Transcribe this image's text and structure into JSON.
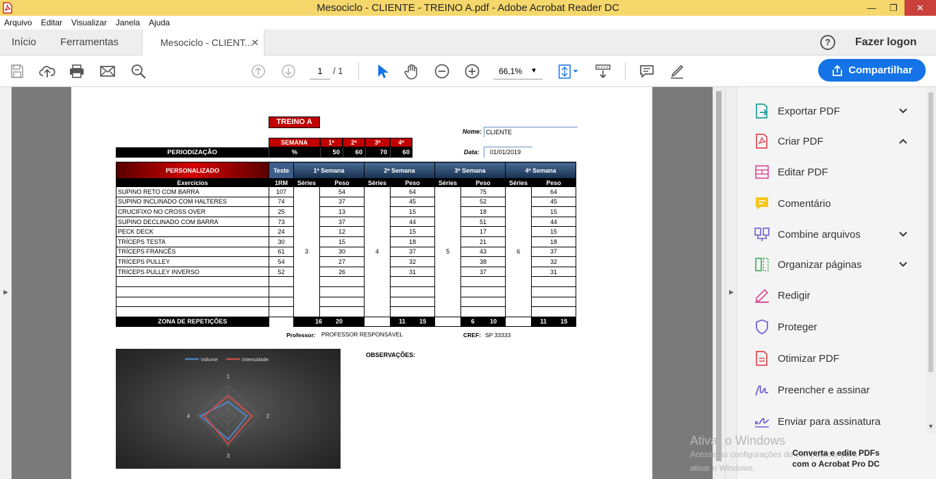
{
  "window": {
    "title": "Mesociclo - CLIENTE  - TREINO A.pdf - Adobe Acrobat Reader DC"
  },
  "menu": [
    "Arquivo",
    "Editar",
    "Visualizar",
    "Janela",
    "Ajuda"
  ],
  "tabs": {
    "home": "Início",
    "tools": "Ferramentas",
    "document": "Mesociclo - CLIENT...",
    "login": "Fazer logon"
  },
  "toolbar": {
    "current_page": "1",
    "total_pages": "/ 1",
    "zoom": "66,1%",
    "share_label": "Compartilhar"
  },
  "tools_pane": [
    {
      "label": "Exportar PDF"
    },
    {
      "label": "Criar PDF"
    },
    {
      "label": "Editar PDF"
    },
    {
      "label": "Comentário"
    },
    {
      "label": "Combine arquivos"
    },
    {
      "label": "Organizar páginas"
    },
    {
      "label": "Redigir"
    },
    {
      "label": "Proteger"
    },
    {
      "label": "Otimizar PDF"
    },
    {
      "label": "Preencher e assinar"
    },
    {
      "label": "Enviar para assinatura"
    }
  ],
  "promo": {
    "line1": "Converta e edite PDFs",
    "line2": "com o Acrobat Pro DC"
  },
  "watermark": {
    "title": "Ativar o Windows",
    "line1": "Acesse as configurações do computador para",
    "line2": "ativar o Windows."
  },
  "doc": {
    "title": "TREINO A",
    "nome_label": "Nome:",
    "nome_value": "CLIENTE",
    "data_label": "Data:",
    "data_value": "01/01/2019",
    "semana_label": "SEMANA",
    "semanas": [
      "1ª",
      "2ª",
      "3ª",
      "4ª"
    ],
    "periodizacao_label": "PERIODIZAÇÃO",
    "percent_label": "%",
    "percentuais": [
      "50",
      "60",
      "70",
      "60"
    ],
    "personalizado": "PERSONALIZADO",
    "teste": "Teste",
    "week_headers": [
      "1ª Semana",
      "2ª Semana",
      "3ª Semana",
      "4ª Semana"
    ],
    "exercicios_label": "Exercícios",
    "rm_label": "1RM",
    "series_label": "Séries",
    "peso_label": "Peso",
    "series_values": [
      "3",
      "4",
      "5",
      "6"
    ],
    "exercises": [
      {
        "name": "SUPINO RETO COM BARRA",
        "rm": "107",
        "w": [
          "54",
          "64",
          "75",
          "64"
        ]
      },
      {
        "name": "SUPINO INCLINADO COM HALTERES",
        "rm": "74",
        "w": [
          "37",
          "45",
          "52",
          "45"
        ]
      },
      {
        "name": "CRUCIFIXO NO CROSS OVER",
        "rm": "25",
        "w": [
          "13",
          "15",
          "18",
          "15"
        ]
      },
      {
        "name": "SUPINO DECLINADO COM BARRA",
        "rm": "73",
        "w": [
          "37",
          "44",
          "51",
          "44"
        ]
      },
      {
        "name": "PECK DECK",
        "rm": "24",
        "w": [
          "12",
          "15",
          "17",
          "15"
        ]
      },
      {
        "name": "TRÍCEPS TESTA",
        "rm": "30",
        "w": [
          "15",
          "18",
          "21",
          "18"
        ]
      },
      {
        "name": "TRÍCEPS FRANCÊS",
        "rm": "61",
        "w": [
          "30",
          "37",
          "43",
          "37"
        ]
      },
      {
        "name": "TRÍCEPS PULLEY",
        "rm": "54",
        "w": [
          "27",
          "32",
          "38",
          "32"
        ]
      },
      {
        "name": "TRÍCEPS PULLEY INVERSO",
        "rm": "52",
        "w": [
          "26",
          "31",
          "37",
          "31"
        ]
      }
    ],
    "zona_label": "ZONA DE REPETIÇÕES",
    "zonas": [
      [
        "16",
        "20"
      ],
      [
        "11",
        "15"
      ],
      [
        "6",
        "10"
      ],
      [
        "11",
        "15"
      ]
    ],
    "professor_label": "Professor:",
    "professor_value": "PROFESSOR RESPONSÁVEL",
    "cref_label": "CREF:",
    "cref_value": "SP 33333",
    "observacoes_label": "OBSERVAÇÕES:"
  },
  "chart_data": {
    "type": "radar",
    "categories": [
      "1",
      "2",
      "3",
      "4"
    ],
    "series": [
      {
        "name": "Volume",
        "color": "#4f81bd",
        "values": [
          3,
          4,
          5,
          6
        ]
      },
      {
        "name": "Intensidade",
        "color": "#c0504d",
        "values": [
          50,
          60,
          70,
          60
        ]
      }
    ],
    "legend": "top"
  }
}
